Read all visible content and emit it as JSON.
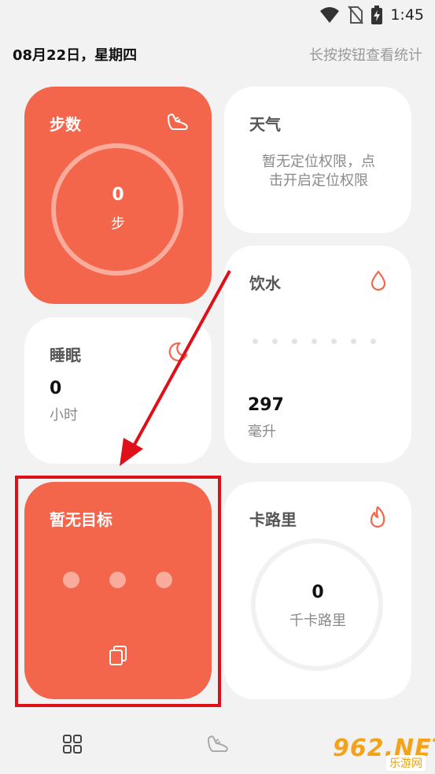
{
  "status_bar": {
    "time": "1:45"
  },
  "header": {
    "date": "08月22日，星期四",
    "hint": "长按按钮查看统计"
  },
  "cards": {
    "steps": {
      "title": "步数",
      "value": "0",
      "unit": "步"
    },
    "weather": {
      "title": "天气",
      "message_line1": "暂无定位权限，点",
      "message_line2": "击开启定位权限"
    },
    "sleep": {
      "title": "睡眠",
      "value": "0",
      "unit": "小时"
    },
    "water": {
      "title": "饮水",
      "value": "297",
      "unit": "毫升"
    },
    "goal": {
      "title": "暂无目标"
    },
    "calorie": {
      "title": "卡路里",
      "value": "0",
      "unit": "千卡路里"
    }
  },
  "watermark": {
    "main": "962.NET",
    "sub": "乐游网"
  },
  "colors": {
    "accent": "#f4664b",
    "highlight": "#e0101b",
    "background": "#f2f2f2"
  },
  "icons": {
    "steps": "shoe-icon",
    "sleep": "moon-icon",
    "water": "water-drop-icon",
    "calorie": "flame-icon",
    "goal": "copy-icon",
    "nav_home": "grid-icon",
    "nav_sport": "shoe-icon"
  }
}
